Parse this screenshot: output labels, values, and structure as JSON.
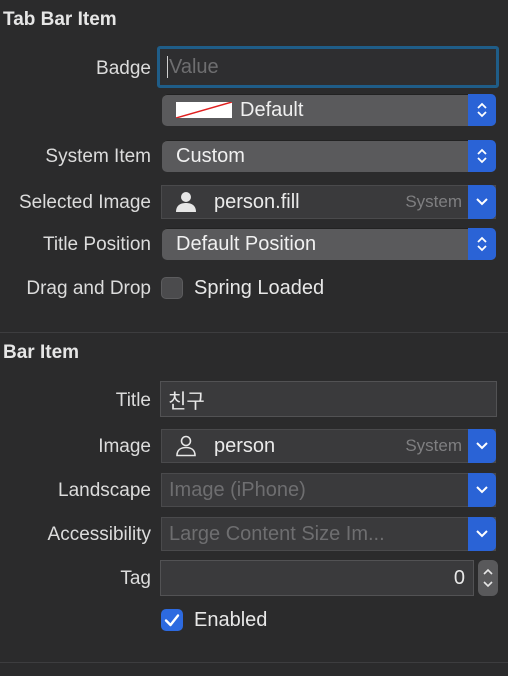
{
  "tab_bar_item": {
    "title": "Tab Bar Item",
    "badge": {
      "label": "Badge",
      "placeholder": "Value",
      "value": ""
    },
    "badge_color": {
      "value": "Default"
    },
    "system_item": {
      "label": "System Item",
      "value": "Custom"
    },
    "selected_image": {
      "label": "Selected Image",
      "value": "person.fill",
      "tag": "System"
    },
    "title_position": {
      "label": "Title Position",
      "value": "Default Position"
    },
    "drag_and_drop": {
      "label": "Drag and Drop",
      "option": "Spring Loaded",
      "checked": false
    }
  },
  "bar_item": {
    "title": "Bar Item",
    "title_field": {
      "label": "Title",
      "value": "친구"
    },
    "image": {
      "label": "Image",
      "value": "person",
      "tag": "System"
    },
    "landscape": {
      "label": "Landscape",
      "placeholder": "Image (iPhone)"
    },
    "accessibility": {
      "label": "Accessibility",
      "placeholder": "Large Content Size Im..."
    },
    "tag": {
      "label": "Tag",
      "value": "0"
    },
    "enabled": {
      "label": "Enabled",
      "checked": true
    }
  },
  "colors": {
    "accent": "#2a63d6",
    "background": "#2b2b2c"
  }
}
